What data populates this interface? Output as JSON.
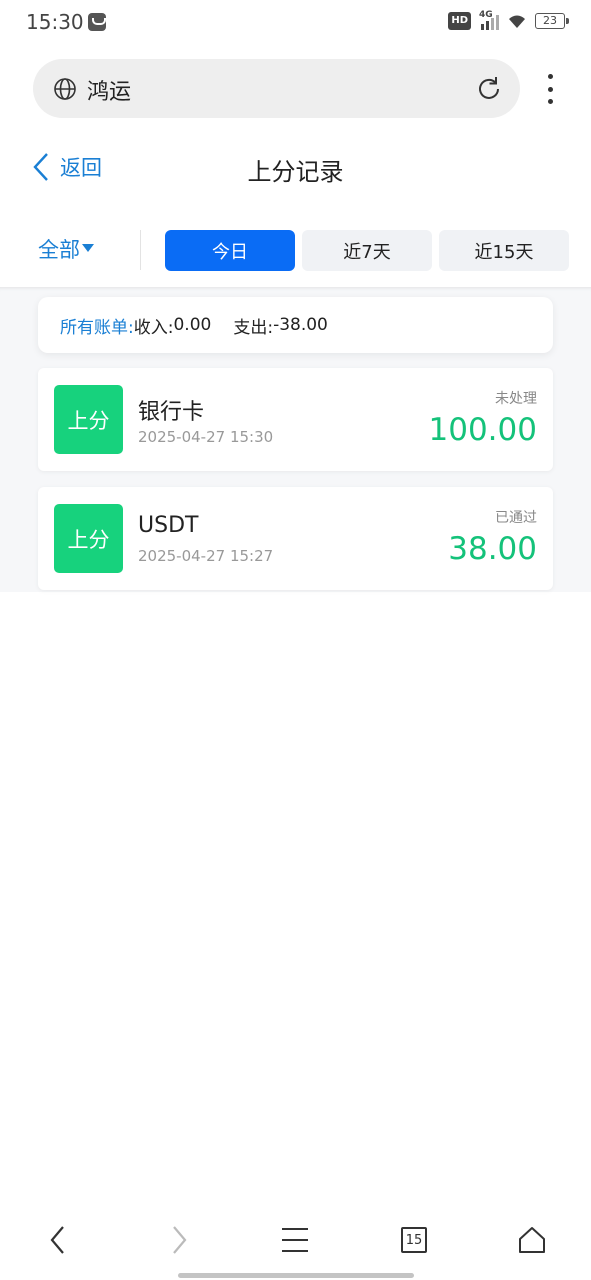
{
  "status_bar": {
    "time": "15:30",
    "network_badge": "HD",
    "network_type": "4G",
    "battery": "23"
  },
  "browser": {
    "site_title": "鸿运",
    "tab_count": "15"
  },
  "header": {
    "back_label": "返回",
    "title": "上分记录"
  },
  "filter": {
    "type_label": "全部",
    "tabs": [
      {
        "label": "今日",
        "active": true
      },
      {
        "label": "近7天",
        "active": false
      },
      {
        "label": "近15天",
        "active": false
      }
    ]
  },
  "summary": {
    "label": "所有账单:",
    "income_label": "收入:",
    "income_value": "0.00",
    "expense_label": "支出:",
    "expense_value": "-38.00"
  },
  "records": [
    {
      "badge": "上分",
      "method": "银行卡",
      "time": "2025-04-27 15:30",
      "status": "未处理",
      "amount": "100.00"
    },
    {
      "badge": "上分",
      "method": "USDT",
      "time": "2025-04-27 15:27",
      "status": "已通过",
      "amount": "38.00"
    }
  ],
  "colors": {
    "accent_blue": "#1a7fd4",
    "active_tab": "#0a6cf5",
    "badge_green": "#17d27d",
    "amount_green": "#14c27a"
  },
  "icons": {
    "address_bar_left": "globe-icon",
    "address_bar_right": "reload-icon",
    "browser_menu": "more-vertical-icon",
    "nav": [
      "back-arrow-icon",
      "forward-arrow-icon",
      "menu-icon",
      "tabs-icon",
      "home-icon"
    ]
  }
}
